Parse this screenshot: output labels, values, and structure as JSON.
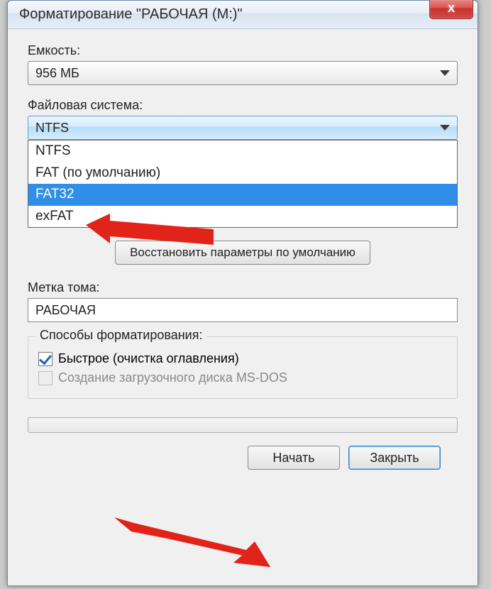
{
  "window": {
    "title": "Форматирование \"РАБОЧАЯ (M:)\"",
    "close_glyph": "X"
  },
  "capacity": {
    "label": "Емкость:",
    "value": "956 МБ"
  },
  "filesystem": {
    "label": "Файловая система:",
    "value": "NTFS",
    "options": [
      "NTFS",
      "FAT (по умолчанию)",
      "FAT32",
      "exFAT"
    ],
    "selected_index": 2
  },
  "restore_defaults": "Восстановить параметры по умолчанию",
  "volume_label": {
    "label": "Метка тома:",
    "value": "РАБОЧАЯ"
  },
  "format_options": {
    "legend": "Способы форматирования:",
    "quick": {
      "label": "Быстрое (очистка оглавления)",
      "checked": true
    },
    "msdos": {
      "label": "Создание загрузочного диска MS-DOS",
      "checked": false,
      "disabled": true
    }
  },
  "buttons": {
    "start": "Начать",
    "close": "Закрыть"
  },
  "annotations": {
    "arrow_top_target": "filesystem.options.2",
    "arrow_bottom_target": "buttons.start"
  }
}
